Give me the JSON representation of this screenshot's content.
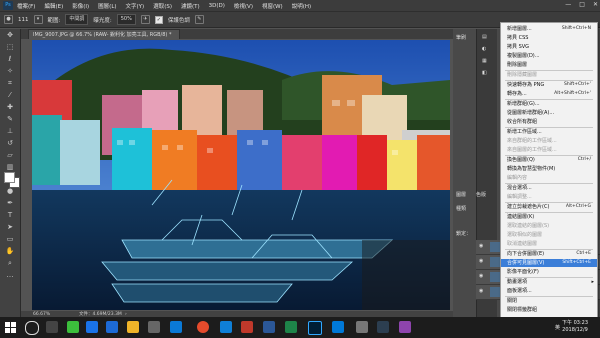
{
  "menubar": {
    "logo": "Ps",
    "items": [
      "檔案(F)",
      "編輯(E)",
      "影像(I)",
      "圖層(L)",
      "文字(Y)",
      "選取(S)",
      "濾鏡(T)",
      "3D(D)",
      "檢視(V)",
      "視窗(W)",
      "說明(H)"
    ]
  },
  "options": {
    "range_label": "範圍:",
    "range_value": "中間調",
    "exposure_label": "曝光度:",
    "exposure_value": "50%",
    "protect_label": "保護色調",
    "size_value": "111"
  },
  "document": {
    "tab_title": "IMG_9007.JPG @ 66.7% (RAW- 銳利化 加亮工具, RGB/8) *",
    "zoom": "66.67%",
    "doc_info": "文件：4.69M/23.3M"
  },
  "panels": {
    "top_tab": "筆刷",
    "bottom_tab_layers": "圖層",
    "bottom_tab_channels": "色版",
    "filter_kind": "種類",
    "lock_label": "鎖定："
  },
  "context_menu": {
    "items": [
      {
        "label": "新增圖層...",
        "shortcut": "Shift+Ctrl+N",
        "disabled": false
      },
      {
        "label": "拷貝 CSS",
        "shortcut": "",
        "disabled": false
      },
      {
        "label": "拷貝 SVG",
        "shortcut": "",
        "disabled": false
      },
      {
        "label": "複製圖層(D)...",
        "shortcut": "",
        "disabled": false
      },
      {
        "label": "刪除圖層",
        "shortcut": "",
        "disabled": false
      },
      {
        "label": "刪除隱藏圖層",
        "shortcut": "",
        "disabled": true
      },
      {
        "label": "快速轉存為 PNG",
        "shortcut": "Shift+Ctrl+'",
        "disabled": false
      },
      {
        "label": "轉存為...",
        "shortcut": "Alt+Shift+Ctrl+'",
        "disabled": false
      },
      {
        "label": "新增群組(G)...",
        "shortcut": "",
        "disabled": false
      },
      {
        "label": "從圖層新增群組(A)...",
        "shortcut": "",
        "disabled": false
      },
      {
        "label": "收合所有群組",
        "shortcut": "",
        "disabled": false
      },
      {
        "label": "新增工作區域...",
        "shortcut": "",
        "disabled": false
      },
      {
        "label": "來自群組的工作區域...",
        "shortcut": "",
        "disabled": true
      },
      {
        "label": "來自圖層的工作區域...",
        "shortcut": "",
        "disabled": true
      },
      {
        "label": "換色圖層(Q)",
        "shortcut": "Ctrl+/",
        "disabled": false
      },
      {
        "label": "轉換為智慧型物件(M)",
        "shortcut": "",
        "disabled": false
      },
      {
        "label": "編輯內容",
        "shortcut": "",
        "disabled": true
      },
      {
        "label": "混合選項...",
        "shortcut": "",
        "disabled": false
      },
      {
        "label": "編輯調整...",
        "shortcut": "",
        "disabled": true
      },
      {
        "label": "建立剪裁遮色片(C)",
        "shortcut": "Alt+Ctrl+G",
        "disabled": false
      },
      {
        "label": "連結圖層(K)",
        "shortcut": "",
        "disabled": false
      },
      {
        "label": "選取連結的圖層(S)",
        "shortcut": "",
        "disabled": true
      },
      {
        "label": "選取相似的圖層",
        "shortcut": "",
        "disabled": true
      },
      {
        "label": "取消連結圖層",
        "shortcut": "",
        "disabled": true
      },
      {
        "label": "向下合併圖層(E)",
        "shortcut": "Ctrl+E",
        "disabled": false
      },
      {
        "label": "合併可見圖層(V)",
        "shortcut": "Shift+Ctrl+E",
        "disabled": false,
        "highlight": true
      },
      {
        "label": "影像平面化(F)",
        "shortcut": "",
        "disabled": false
      },
      {
        "label": "動畫選項",
        "shortcut": "",
        "disabled": false,
        "submenu": true
      },
      {
        "label": "面板選項...",
        "shortcut": "",
        "disabled": false
      },
      {
        "label": "關閉",
        "shortcut": "",
        "disabled": false
      },
      {
        "label": "關閉標籤群組",
        "shortcut": "",
        "disabled": false
      }
    ]
  },
  "taskbar": {
    "ime": "英",
    "time": "下午 03:23",
    "date": "2018/12/9"
  },
  "colors": {
    "accent": "#3b7ed8",
    "menu_bg": "#f2f2f2",
    "chrome": "#3c3c3c"
  }
}
